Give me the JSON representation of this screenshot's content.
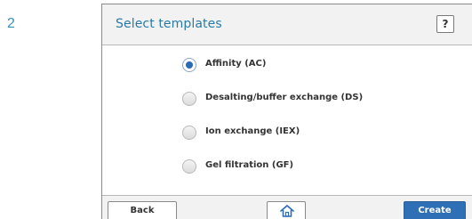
{
  "step_number": "2",
  "header": {
    "title": "Select templates",
    "help_label": "?"
  },
  "options": [
    {
      "label": "Affinity (AC)",
      "selected": true
    },
    {
      "label": "Desalting/buffer exchange (DS)",
      "selected": false
    },
    {
      "label": "Ion exchange (IEX)",
      "selected": false
    },
    {
      "label": "Gel filtration (GF)",
      "selected": false
    }
  ],
  "footer": {
    "back_label": "Back",
    "home_icon": "home-icon",
    "create_label": "Create"
  },
  "colors": {
    "title": "#2a7aa8",
    "accent": "#2e6fb5",
    "step_number": "#3a90b8"
  }
}
